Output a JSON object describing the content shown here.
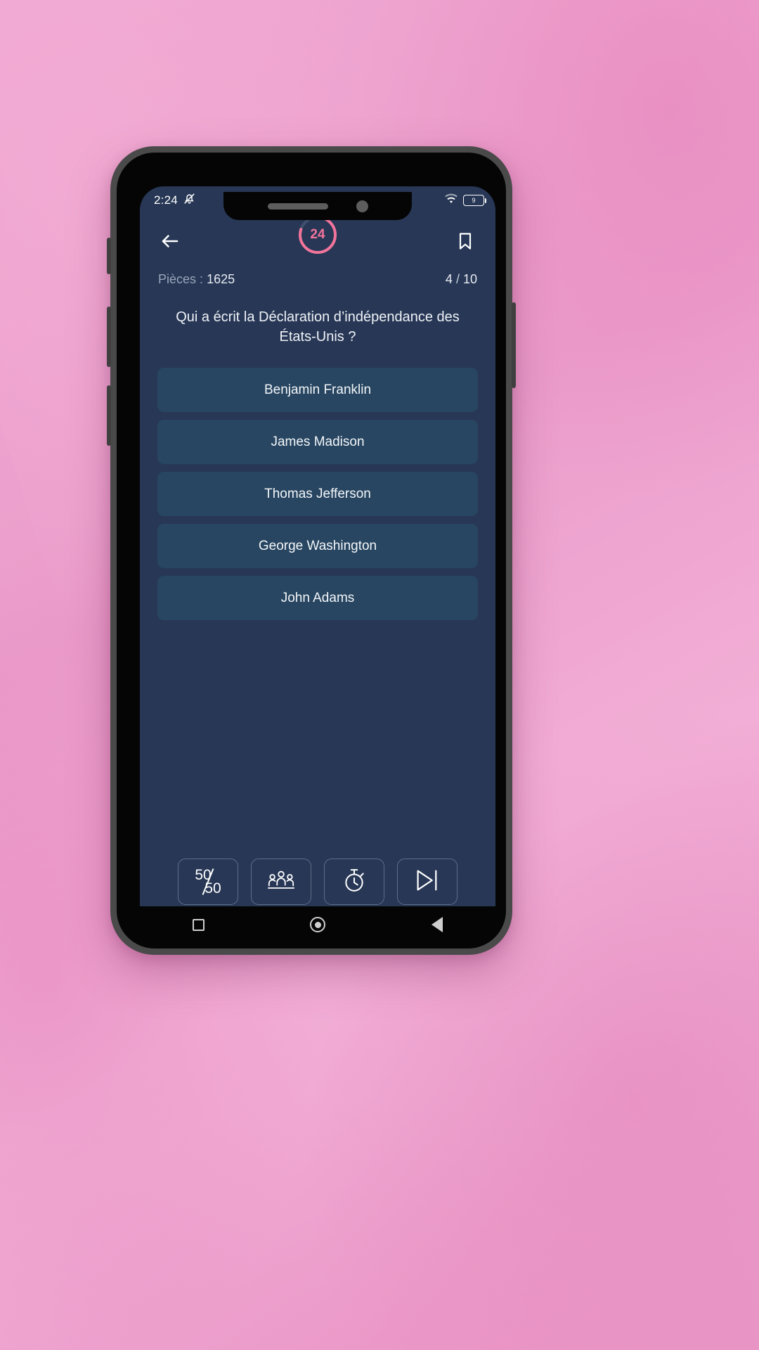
{
  "status_bar": {
    "clock": "2:24",
    "mute_icon": "bell-muted-icon",
    "wifi_icon": "wifi-icon",
    "battery_icon": "battery-icon",
    "battery_level": "9"
  },
  "header": {
    "back_icon": "back-arrow-icon",
    "bookmark_icon": "bookmark-icon",
    "timer_value": "24",
    "timer_max": 30,
    "timer_color": "#f2749b",
    "timer_track_color": "#3f4f6d"
  },
  "info": {
    "pieces_label": "Pièces",
    "pieces_separator": ":",
    "pieces_value": "1625",
    "current_question": "4",
    "question_separator": "/",
    "total_questions": "10"
  },
  "question": {
    "text": "Qui a écrit la Déclaration d’indépendance des États-Unis ?"
  },
  "answers": [
    {
      "label": "Benjamin Franklin"
    },
    {
      "label": "James Madison"
    },
    {
      "label": "Thomas Jefferson"
    },
    {
      "label": "George Washington"
    },
    {
      "label": "John Adams"
    }
  ],
  "lifelines": [
    {
      "name": "fifty-fifty",
      "top": "50",
      "bottom": "50"
    },
    {
      "name": "ask-audience",
      "icon": "people-group-icon"
    },
    {
      "name": "extra-time",
      "icon": "stopwatch-icon"
    },
    {
      "name": "skip-question",
      "icon": "skip-next-icon"
    }
  ],
  "navbar": {
    "recents_icon": "square-icon",
    "home_icon": "circle-icon",
    "back_icon": "triangle-back-icon"
  },
  "theme": {
    "screen_bg": "#273755",
    "answer_bg": "#284661",
    "accent": "#f2749b",
    "backdrop": "#eda0cd"
  }
}
